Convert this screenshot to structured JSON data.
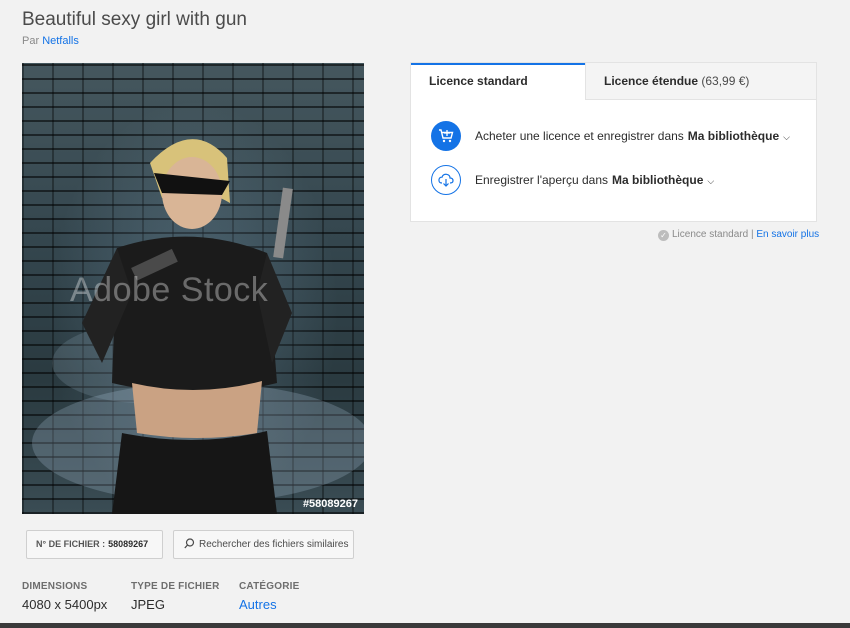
{
  "title": "Beautiful sexy girl with gun",
  "byline": {
    "prefix": "Par",
    "author": "Netfalls"
  },
  "preview": {
    "watermark": "Adobe Stock",
    "file_tag": "#58089267"
  },
  "file_id": {
    "label": "N° DE FICHIER :",
    "value": "58089267"
  },
  "similar_button": {
    "label": "Rechercher des fichiers similaires",
    "icon": "search-icon"
  },
  "meta": [
    {
      "label": "DIMENSIONS",
      "value": "4080 x 5400px"
    },
    {
      "label": "TYPE DE FICHIER",
      "value": "JPEG"
    },
    {
      "label": "CATÉGORIE",
      "value": "Autres"
    }
  ],
  "licence": {
    "tabs": [
      {
        "label": "Licence standard",
        "price": ""
      },
      {
        "label": "Licence étendue",
        "price": "(63,99 €)"
      }
    ],
    "actions": [
      {
        "text": "Acheter une licence et enregistrer dans",
        "library": "Ma bibliothèque",
        "icon": "cart-icon"
      },
      {
        "text": "Enregistrer l'aperçu dans",
        "library": "Ma bibliothèque",
        "icon": "cloud-download-icon"
      }
    ],
    "note": {
      "text": "Licence standard |",
      "link": "En savoir plus"
    }
  },
  "colors": {
    "accent": "#1473e6",
    "background": "#f2f2f2"
  }
}
